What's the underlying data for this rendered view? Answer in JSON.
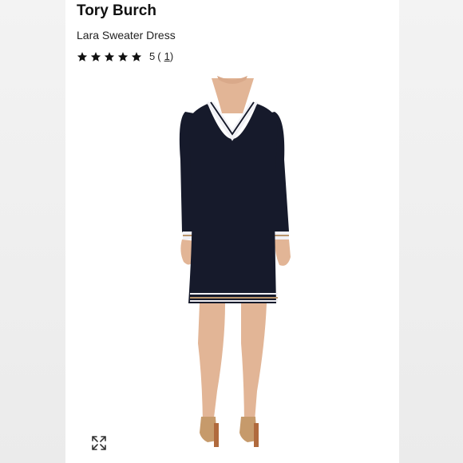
{
  "product": {
    "brand": "Tory Burch",
    "name": "Lara Sweater Dress",
    "rating": {
      "stars": 5,
      "score": "5",
      "count": "1"
    }
  },
  "icons": {
    "star": "star-icon",
    "expand": "expand-icon"
  },
  "colors": {
    "dress": "#161a2b",
    "trim_white": "#f0f0f5",
    "trim_tan": "#b9946b",
    "skin": "#e2b596"
  }
}
